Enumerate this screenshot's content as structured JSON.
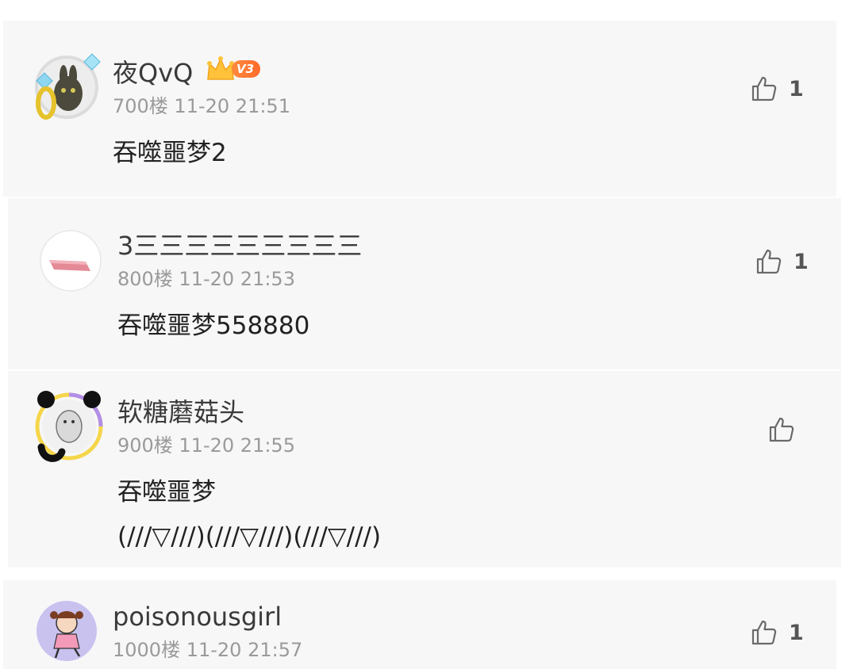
{
  "comments": [
    {
      "username": "夜QvQ",
      "badge": "V3",
      "floor_time": "700楼 11-20 21:51",
      "content": [
        "吞噬噩梦2"
      ],
      "likes": "1"
    },
    {
      "username": "3三三三三三三三三三",
      "floor_time": "800楼 11-20 21:53",
      "content": [
        "吞噬噩梦558880"
      ],
      "likes": "1"
    },
    {
      "username": "软糖蘑菇头",
      "floor_time": "900楼 11-20 21:55",
      "content": [
        "吞噬噩梦",
        "(///▽///)(///▽///)(///▽///)"
      ],
      "likes": ""
    },
    {
      "username": "poisonousgirl",
      "floor_time": "1000楼 11-20 21:57",
      "content": [],
      "likes": "1"
    }
  ],
  "colors": {
    "panel_bg": "#f7f7f8",
    "username": "#3a3a3a",
    "meta": "#9a9a9a",
    "text": "#222222",
    "badge": "#ff7a33"
  },
  "icons": [
    "thumbs-up-icon",
    "crown-icon",
    "avatar-image"
  ]
}
